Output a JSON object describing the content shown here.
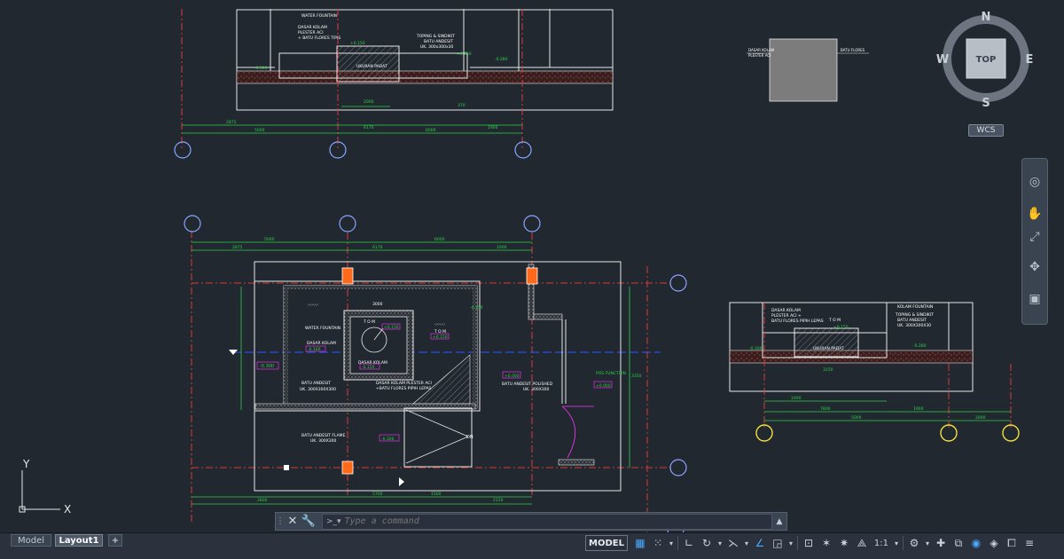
{
  "viewcube": {
    "north": "N",
    "south": "S",
    "east": "E",
    "west": "W",
    "face": "TOP",
    "ucs_label": "WCS"
  },
  "ucs_axes": {
    "x": "X",
    "y": "Y"
  },
  "command_line": {
    "placeholder": "Type a command"
  },
  "layout_tabs": {
    "model": "Model",
    "layout1": "Layout1",
    "add": "+"
  },
  "status_bar": {
    "model_label": "MODEL",
    "scale": "1:1"
  },
  "drawing": {
    "top_section": {
      "labels": [
        "WATER FOUNTAIN",
        "DASAR KOLAM",
        "PLESTER ACI",
        "+ BATU FLORES TIPIS",
        "TOPING & SINDIKIT",
        "BATU ANDESIT",
        "UK. 300x300x30",
        "UKURAN PADAT"
      ],
      "levels": [
        "-0.300",
        "+0.150",
        "+0.150",
        "-0.280"
      ],
      "dims": [
        "2875",
        "5000",
        "6170",
        "6000",
        "1900",
        "2000",
        "370"
      ]
    },
    "plan": {
      "labels": [
        "WATER FOUNTAIN",
        "DASAR KOLAM",
        "DASAR KOLAM",
        "BATU ANDESIT",
        "UK. 300X300X300",
        "DASAR KOLAM PLESTER ACI",
        "+BATU FLORES PIPIH LEPAS",
        "BATU ANDESIT POLISHED",
        "UK. 300X300",
        "BATU ANDESIT FLAME",
        "UK. 300X300",
        "POS FUNCTION",
        "DN"
      ],
      "tom": [
        "T O M",
        "T O M"
      ],
      "levels": [
        "+0.150",
        "+0.150",
        "-0.300",
        "-0.160",
        "-0.150",
        "-0.300",
        "+0.000",
        "+0.000",
        "-0.150"
      ],
      "dims": [
        "2875",
        "5000",
        "6170",
        "6000",
        "1900",
        "3000",
        "2150",
        "1500",
        "5700",
        "2800",
        "3350"
      ]
    },
    "right_section": {
      "labels": [
        "DASAR KOLAM",
        "PLESTER ACI +",
        "BATU FLORES PIPIH LEPAS",
        "KOLAM FOUNTAIN",
        "TOPING & SINDIKIT",
        "BATU ANDESIT",
        "UK. 300X300X30",
        "UKURAN PADAT"
      ],
      "tom": "T O M",
      "levels": [
        "-0.300",
        "+0.150",
        "-0.280"
      ],
      "dims": [
        "1900",
        "7800",
        "5000",
        "1900",
        "2000",
        "3150"
      ]
    },
    "detail": {
      "labels": [
        "DASAR KOLAM",
        "PLESTER ACI",
        "BATU FLORES"
      ]
    }
  },
  "colors": {
    "background": "#212830",
    "line": "#e8e8e8",
    "dimension": "#2fd14a",
    "label": "#ffffff",
    "level_box": "#ff33ff",
    "hatch": "#9a9a9a",
    "grid_bubble": "#8aa6ff",
    "column": "#ff6a1a",
    "center_line": "#d83a3a",
    "blue_line": "#2b4fe0",
    "yellow_bubble": "#f0e040"
  },
  "icons": [
    "close-icon",
    "wrench-icon",
    "command-prompt-icon",
    "chevron-up-icon",
    "grid-icon",
    "snap-icon",
    "ortho-icon",
    "polar-icon",
    "isodraft-icon",
    "osnap-icon",
    "annotation-icon",
    "gear-icon",
    "plus-icon",
    "workspace-icon",
    "isolate-icon",
    "hardware-accel-icon",
    "fullscreen-icon",
    "hamburger-icon",
    "steering-wheel-icon",
    "pan-icon",
    "zoom-icon",
    "orbit-icon",
    "showmotion-icon"
  ]
}
